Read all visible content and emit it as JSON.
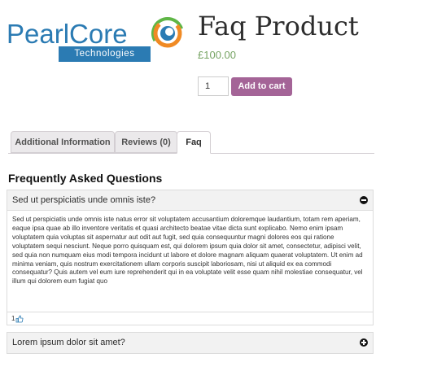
{
  "logo": {
    "name": "PearlCore",
    "tagline": "Technologies"
  },
  "product": {
    "title": "Faq Product",
    "price": "£100.00",
    "quantity": "1",
    "add_to_cart_label": "Add to cart"
  },
  "tabs": [
    {
      "label": "Additional Information",
      "active": false
    },
    {
      "label": "Reviews (0)",
      "active": false
    },
    {
      "label": "Faq",
      "active": true
    }
  ],
  "faq": {
    "heading": "Frequently Asked Questions",
    "items": [
      {
        "question": "Sed ut perspiciatis unde omnis iste?",
        "expanded": true,
        "toggle_icon": "minus-circle-icon",
        "answer": "Sed ut perspiciatis unde omnis iste natus error sit voluptatem accusantium doloremque laudantium, totam rem aperiam, eaque ipsa quae ab illo inventore veritatis et quasi architecto beatae vitae dicta sunt explicabo. Nemo enim ipsam voluptatem quia voluptas sit aspernatur aut odit aut fugit, sed quia consequuntur magni dolores eos qui ratione voluptatem sequi nesciunt. Neque porro quisquam est, qui dolorem ipsum quia dolor sit amet, consectetur, adipisci velit, sed quia non numquam eius modi tempora incidunt ut labore et dolore magnam aliquam quaerat voluptatem. Ut enim ad minima veniam, quis nostrum exercitationem ullam corporis suscipit laboriosam, nisi ut aliquid ex ea commodi consequatur? Quis autem vel eum iure reprehenderit qui in ea voluptate velit esse quam nihil molestiae consequatur, vel illum qui dolorem eum fugiat quo",
        "likes": "1",
        "like_icon": "thumbs-up-icon"
      },
      {
        "question": "Lorem ipsum dolor sit amet?",
        "expanded": false,
        "toggle_icon": "plus-circle-icon"
      }
    ]
  },
  "colors": {
    "logo_blue": "#2b7bb3",
    "logo_orange": "#f08a24",
    "logo_green": "#5fb646",
    "price_green": "#77a464",
    "button_purple": "#a46497"
  }
}
